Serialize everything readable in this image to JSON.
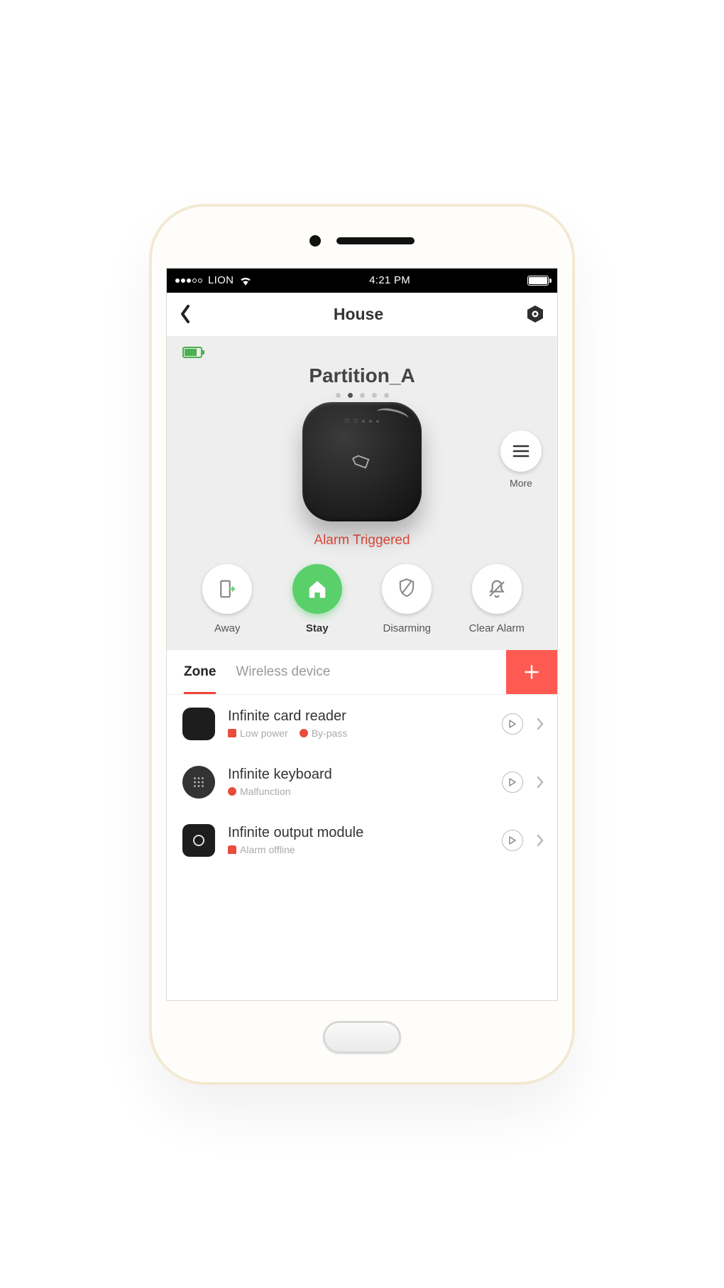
{
  "statusBar": {
    "carrier": "LION",
    "time": "4:21 PM"
  },
  "nav": {
    "title": "House"
  },
  "hero": {
    "partitionName": "Partition_A",
    "pagerDots": 5,
    "activeDot": 1,
    "moreLabel": "More",
    "alarmStatus": "Alarm Triggered"
  },
  "actions": [
    {
      "key": "away",
      "label": "Away",
      "active": false
    },
    {
      "key": "stay",
      "label": "Stay",
      "active": true
    },
    {
      "key": "disarming",
      "label": "Disarming",
      "active": false
    },
    {
      "key": "clearalarm",
      "label": "Clear Alarm",
      "active": false
    }
  ],
  "tabs": [
    {
      "key": "zone",
      "label": "Zone",
      "active": true
    },
    {
      "key": "wireless",
      "label": "Wireless device",
      "active": false
    }
  ],
  "zones": [
    {
      "name": "Infinite card reader",
      "tags": [
        "Low power",
        "By-pass"
      ],
      "iconStyle": "square"
    },
    {
      "name": "Infinite keyboard",
      "tags": [
        "Malfunction"
      ],
      "iconStyle": "round-grid"
    },
    {
      "name": "Infinite output module",
      "tags": [
        "Alarm offline"
      ],
      "iconStyle": "square-ring"
    }
  ],
  "colors": {
    "accent": "#ff5a52",
    "danger": "#e74c3c",
    "success": "#5ad06b"
  }
}
